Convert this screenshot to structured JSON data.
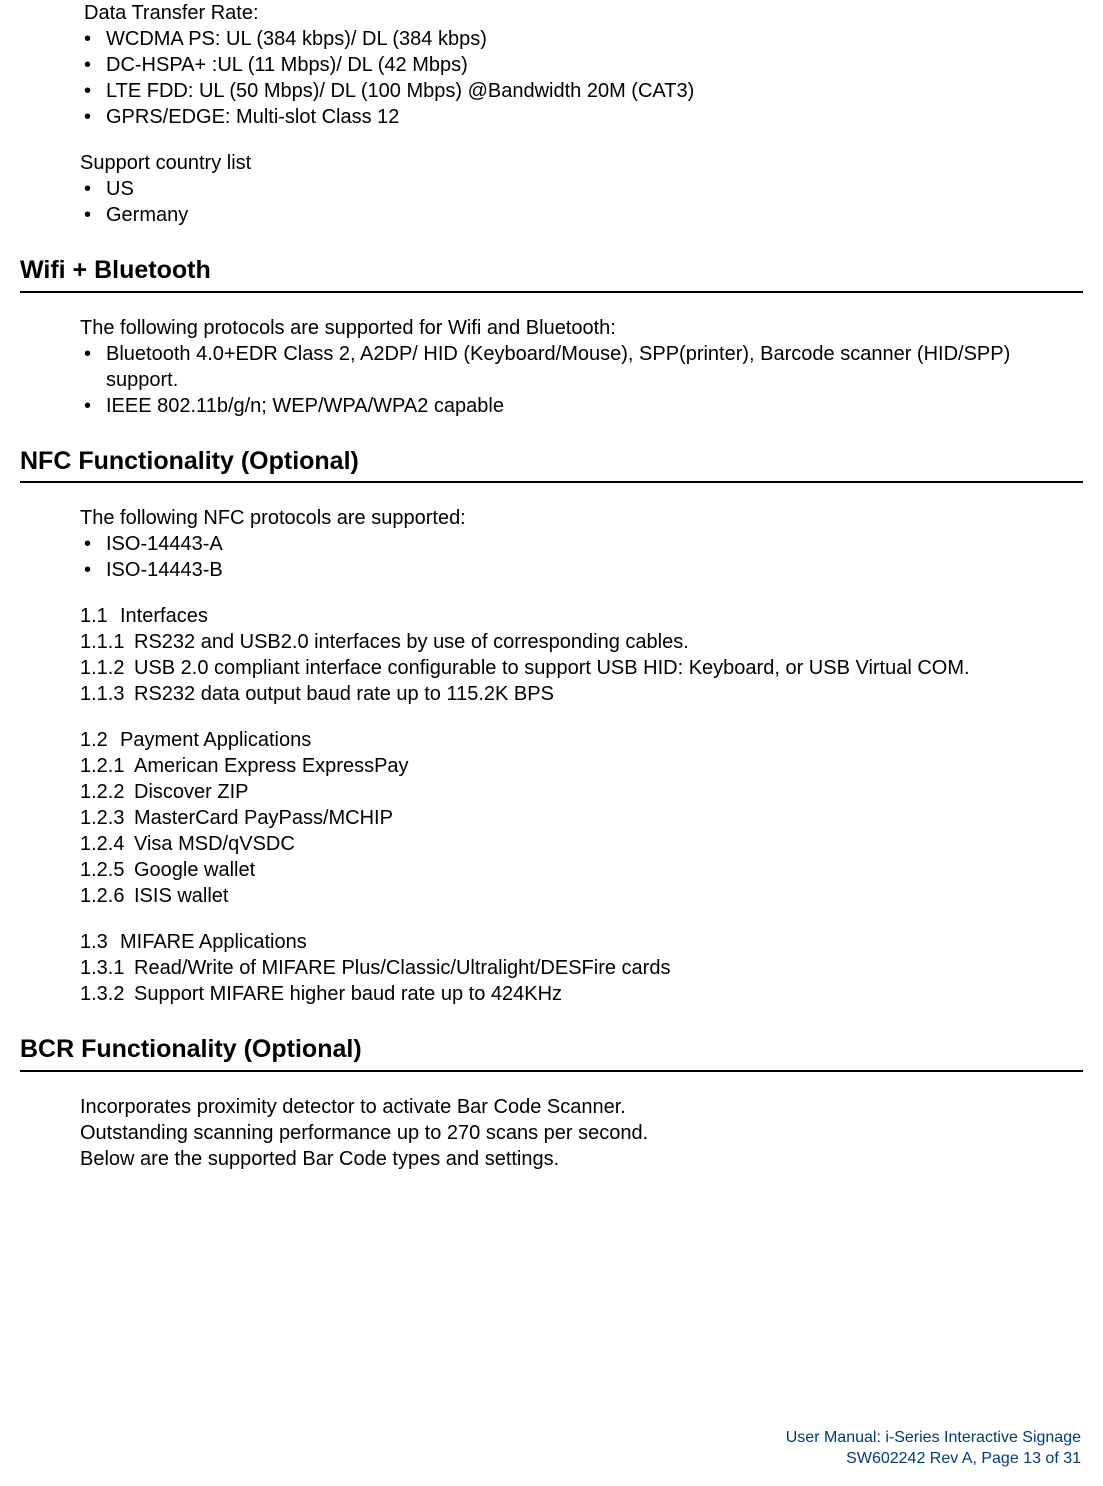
{
  "topBlock": {
    "title": "Data Transfer Rate:",
    "rates": [
      "WCDMA PS: UL (384 kbps)/ DL (384 kbps)",
      "DC-HSPA+ :UL (11 Mbps)/ DL (42 Mbps)",
      "LTE FDD: UL (50 Mbps)/ DL (100 Mbps) @Bandwidth 20M (CAT3)",
      "GPRS/EDGE: Multi-slot Class 12"
    ],
    "supportTitle": "Support country list",
    "countries": [
      "US",
      "Germany"
    ]
  },
  "wifi": {
    "heading": "Wifi + Bluetooth",
    "intro": "The following protocols are supported for Wifi and Bluetooth:",
    "items": [
      "Bluetooth 4.0+EDR Class 2, A2DP/ HID (Keyboard/Mouse), SPP(printer), Barcode scanner (HID/SPP) support.",
      "IEEE 802.11b/g/n; WEP/WPA/WPA2 capable"
    ]
  },
  "nfc": {
    "heading": "NFC Functionality (Optional)",
    "intro": "The following NFC protocols are supported:",
    "protocols": [
      "ISO-14443-A",
      "ISO-14443-B"
    ],
    "sec1": {
      "num": "1.1",
      "title": "Interfaces"
    },
    "sec1items": [
      {
        "num": "1.1.1",
        "txt": "RS232 and USB2.0 interfaces by use of corresponding cables."
      },
      {
        "num": "1.1.2",
        "txt": "USB 2.0 compliant interface configurable to support USB HID: Keyboard, or USB Virtual COM."
      },
      {
        "num": "1.1.3",
        "txt": "RS232 data output baud rate up to 115.2K BPS"
      }
    ],
    "sec2": {
      "num": "1.2",
      "title": "Payment Applications"
    },
    "sec2items": [
      {
        "num": "1.2.1",
        "txt": "American Express ExpressPay"
      },
      {
        "num": "1.2.2",
        "txt": "Discover ZIP"
      },
      {
        "num": "1.2.3",
        "txt": "MasterCard PayPass/MCHIP"
      },
      {
        "num": "1.2.4",
        "txt": "Visa MSD/qVSDC"
      },
      {
        "num": "1.2.5",
        "txt": "Google wallet"
      },
      {
        "num": "1.2.6",
        "txt": "ISIS wallet"
      }
    ],
    "sec3": {
      "num": "1.3",
      "title": "MIFARE Applications"
    },
    "sec3items": [
      {
        "num": "1.3.1",
        "txt": "Read/Write of MIFARE Plus/Classic/Ultralight/DESFire cards"
      },
      {
        "num": "1.3.2",
        "txt": "Support MIFARE higher baud rate up to 424KHz"
      }
    ]
  },
  "bcr": {
    "heading": "BCR Functionality (Optional)",
    "lines": [
      "Incorporates proximity detector to activate Bar Code Scanner.",
      "Outstanding scanning performance up to 270 scans per second.",
      "Below are the supported Bar Code types and settings."
    ]
  },
  "footer": {
    "line1": "User Manual: i-Series Interactive Signage",
    "line2": "SW602242 Rev A, Page 13 of 31"
  }
}
